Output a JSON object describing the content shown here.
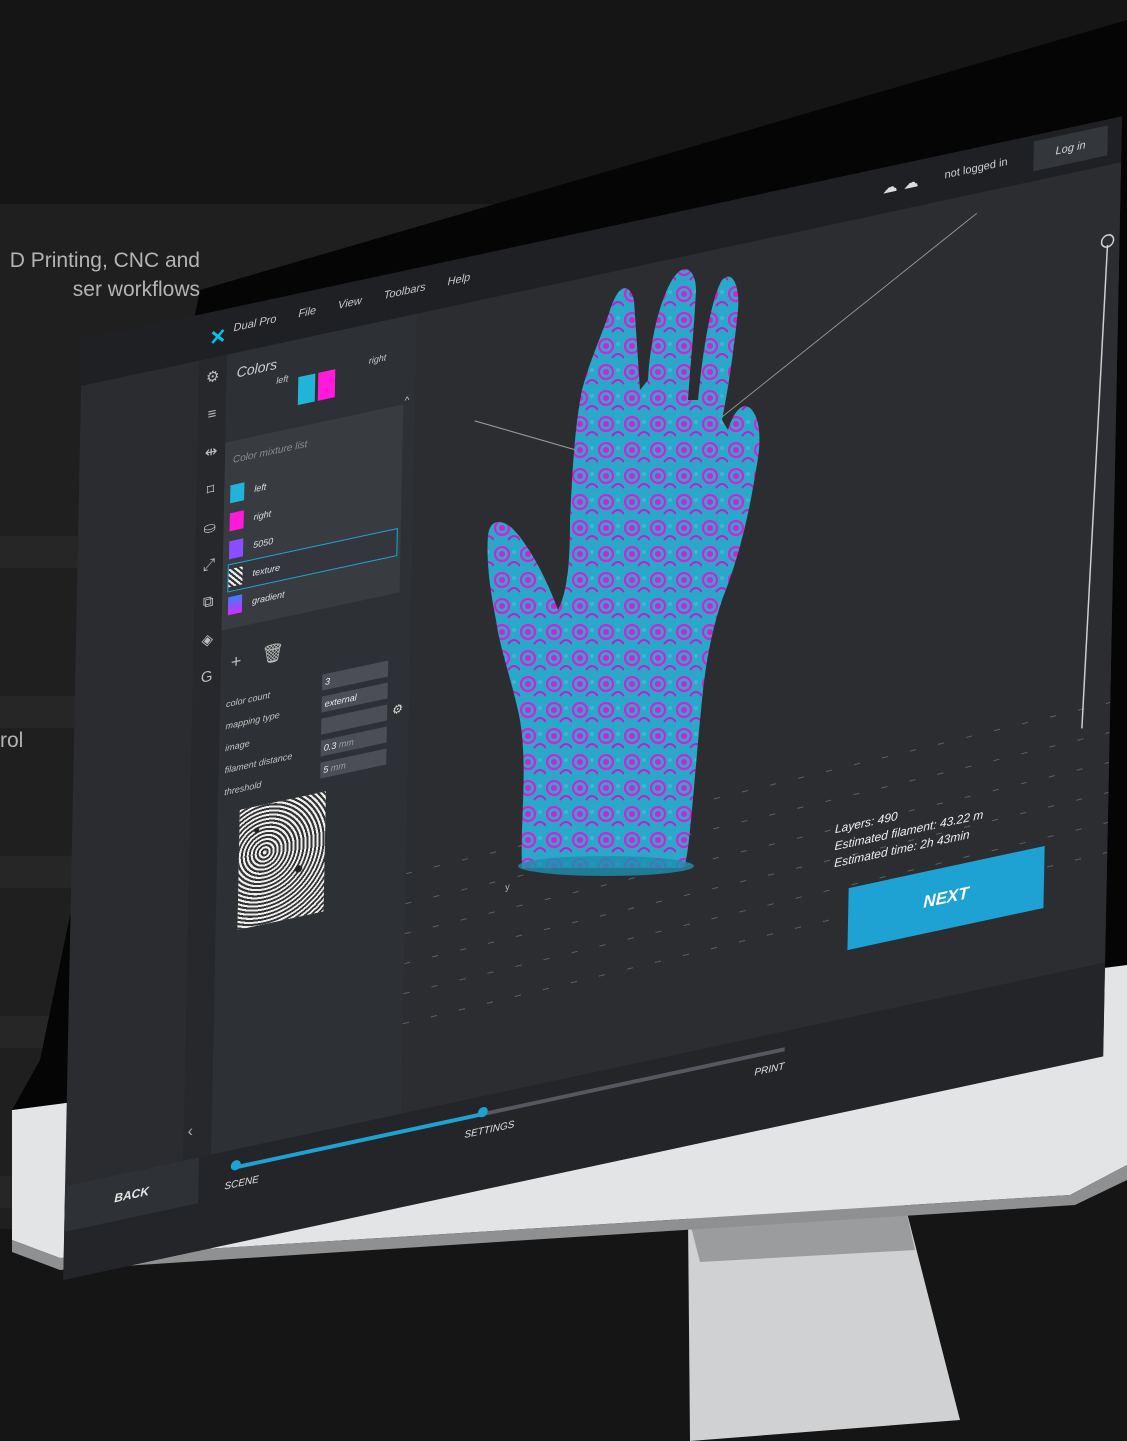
{
  "background": {
    "tagline": "D Printing, CNC and\nser workflows",
    "fragment": "rol"
  },
  "topbar": {
    "device": "Dual Pro",
    "menu": [
      "File",
      "View",
      "Toolbars",
      "Help"
    ],
    "status": "not logged in",
    "login_label": "Log in"
  },
  "panel": {
    "title": "Colors",
    "left_label": "left",
    "right_label": "right",
    "mixture_placeholder": "Color mixture list",
    "items": [
      {
        "label": "left",
        "color": "#1fb4d8"
      },
      {
        "label": "right",
        "color": "#ff1ad9"
      },
      {
        "label": "5050",
        "color": "#8a4dff"
      },
      {
        "label": "texture",
        "color": "#dddddd"
      },
      {
        "label": "gradient",
        "color": "#a03cff"
      }
    ],
    "selected_item": "texture",
    "form": {
      "color_count_label": "color count",
      "color_count_value": "3",
      "mapping_type_label": "mapping type",
      "mapping_type_value": "external",
      "image_label": "image",
      "image_value": "",
      "filament_distance_label": "filament distance",
      "filament_distance_value": "0.3",
      "filament_distance_unit": "mm",
      "threshold_label": "threshold",
      "threshold_value": "5",
      "threshold_unit": "mm"
    }
  },
  "viewport": {
    "axis_label": "y",
    "layers": "Layers: 490",
    "filament": "Estimated filament: 43.22 m",
    "time": "Estimated time: 2h 43min",
    "next_label": "NEXT"
  },
  "bottombar": {
    "back_label": "BACK",
    "steps": [
      "SCENE",
      "SETTINGS",
      "PRINT"
    ],
    "progress": 0.45
  },
  "colors": {
    "accent": "#1ea2d3",
    "cyan": "#1fb4d8",
    "magenta": "#ff1ad9"
  }
}
